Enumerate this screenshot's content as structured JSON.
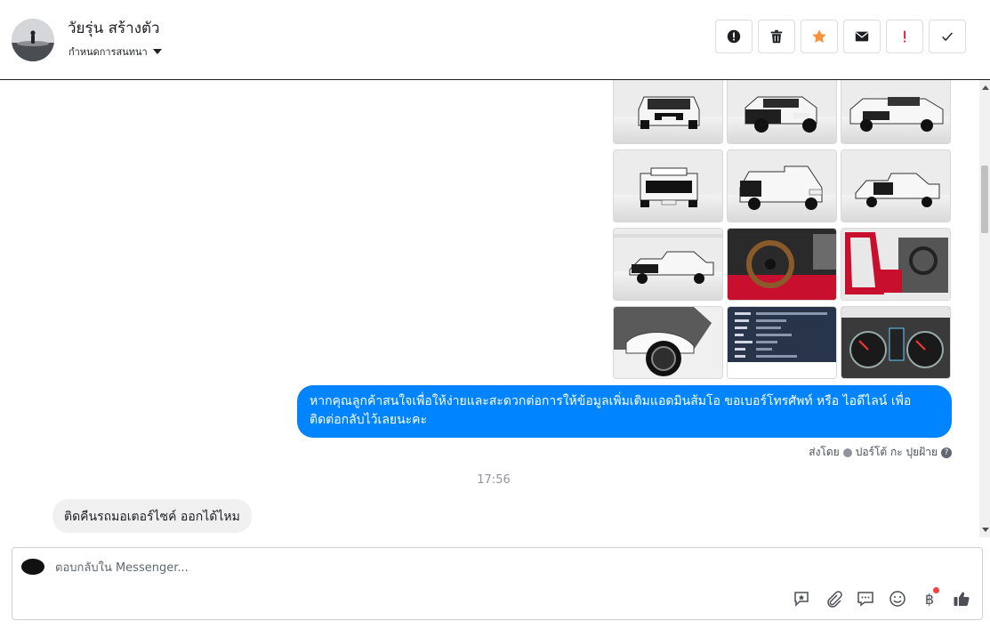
{
  "header": {
    "contact_name": "วัยรุ่น สร้างตัว",
    "assign_label": "กำหนดการสนทนา",
    "actions": [
      {
        "icon": "alert-circle-icon",
        "name": "spam-button"
      },
      {
        "icon": "trash-icon",
        "name": "delete-button"
      },
      {
        "icon": "star-icon",
        "name": "star-button",
        "color": "#f7923b"
      },
      {
        "icon": "envelope-icon",
        "name": "mark-unread-button"
      },
      {
        "icon": "exclamation-icon",
        "name": "follow-up-button",
        "color": "#e41e3f"
      },
      {
        "icon": "check-icon",
        "name": "mark-done-button"
      }
    ]
  },
  "conversation": {
    "photo_count": 12,
    "outgoing_message": "หากคุณลูกค้าสนใจเพื่อให้ง่ายและสะดวกต่อการให้ข้อมูลเพิ่มเติมแอดมินส้มโอ ขอเบอร์โทรศัพท์ หรือ ไอดีไลน์ เพื่อติดต่อกลับไว้เลยนะคะ",
    "sent_by_prefix": "ส่งโดย",
    "sent_by_name": "ปอร์โต้ กะ ปุยฝ้าย",
    "timestamp": "17:56",
    "incoming_message": "ติดคืนรถมอเตอร์ไซค์  ออกได้ไหม"
  },
  "composer": {
    "placeholder": "ตอบกลับใน Messenger...",
    "tools": [
      "saved-reply-icon",
      "attachment-icon",
      "chat-icon",
      "emoji-icon",
      "baht-icon",
      "thumbs-up-icon"
    ],
    "baht_symbol": "฿"
  },
  "colors": {
    "outgoing_bubble": "#0084ff",
    "incoming_bubble": "#f1f0f0",
    "star": "#f7923b",
    "alert": "#e41e3f"
  }
}
